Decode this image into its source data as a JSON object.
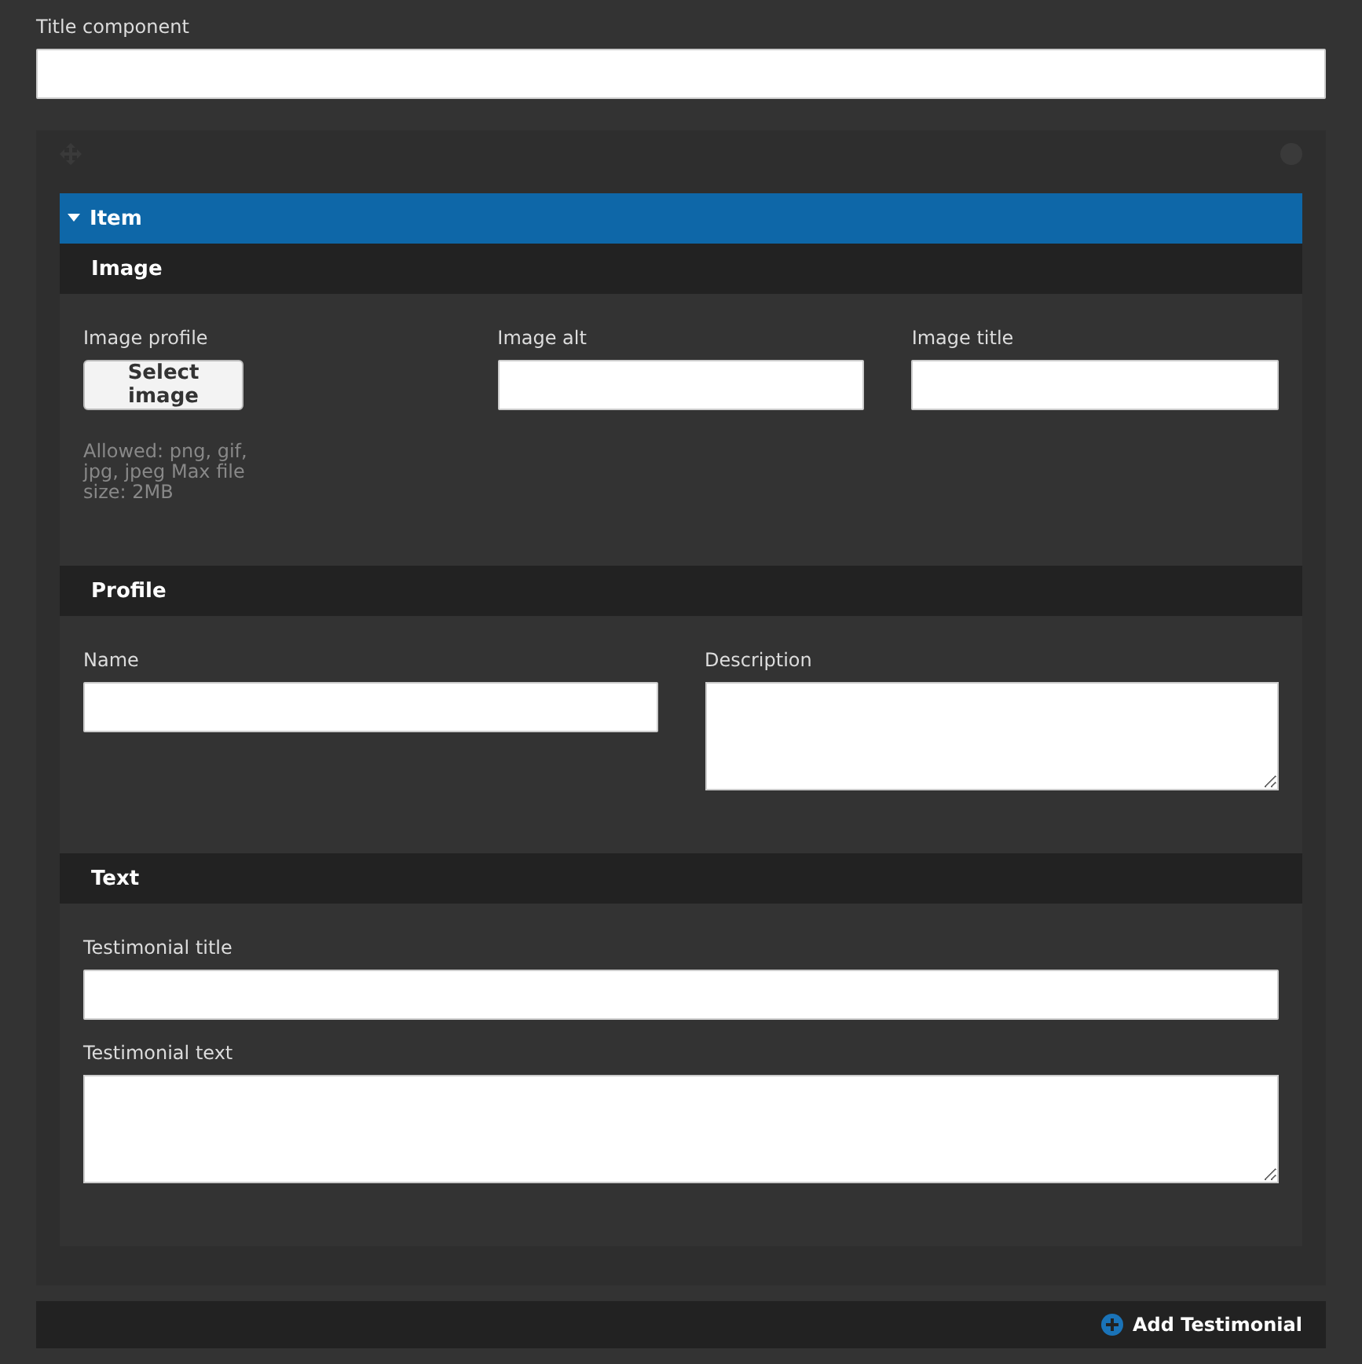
{
  "title_field": {
    "label": "Title component"
  },
  "item": {
    "title": "Item",
    "expanded": true,
    "sections": [
      {
        "title": "Image",
        "kind": "row",
        "fields": [
          {
            "kind": "file",
            "label": "Image profile",
            "button": "Select image",
            "hint": "Allowed: png, gif, jpg, jpeg Max file size: 2MB"
          },
          {
            "kind": "input",
            "label": "Image alt"
          },
          {
            "kind": "input",
            "label": "Image title"
          }
        ]
      },
      {
        "title": "Profile",
        "kind": "row",
        "fields": [
          {
            "kind": "input",
            "label": "Name"
          },
          {
            "kind": "textarea",
            "label": "Description"
          }
        ]
      },
      {
        "title": "Text",
        "kind": "stack",
        "fields": [
          {
            "kind": "input",
            "label": "Testimonial title"
          },
          {
            "kind": "textarea",
            "label": "Testimonial text"
          }
        ]
      }
    ]
  },
  "add_button": "Add Testimonial"
}
